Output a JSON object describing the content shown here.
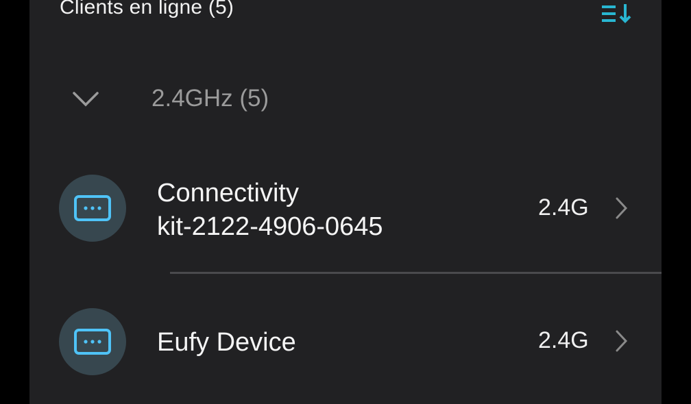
{
  "header": {
    "title": "Clients en ligne (5)",
    "sort_icon": "sort-descending-icon",
    "accent_color": "#29b6d1"
  },
  "group": {
    "label": "2.4GHz (5)",
    "toggle_icon": "chevron-down-icon"
  },
  "clients": [
    {
      "name": "Connectivity",
      "subtitle": "kit-2122-4906-0645",
      "band": "2.4G",
      "icon": "device-icon",
      "icon_color": "#4fc3f7"
    },
    {
      "name": "Eufy Device",
      "subtitle": "",
      "band": "2.4G",
      "icon": "device-icon",
      "icon_color": "#4fc3f7"
    }
  ]
}
